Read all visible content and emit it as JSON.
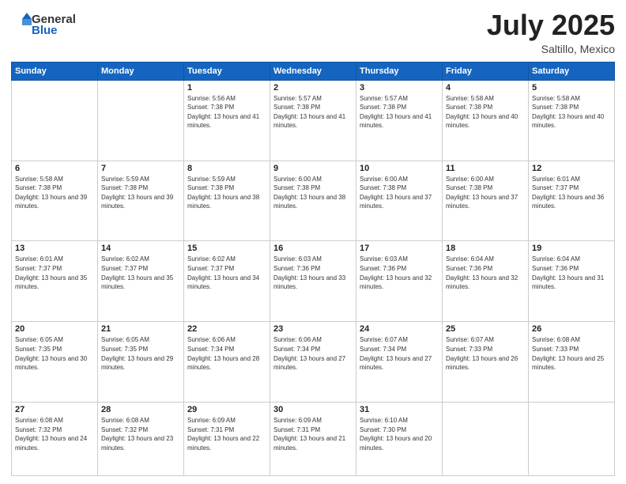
{
  "header": {
    "logo": {
      "line1": "General",
      "line2": "Blue"
    },
    "title": "July 2025",
    "subtitle": "Saltillo, Mexico"
  },
  "days_of_week": [
    "Sunday",
    "Monday",
    "Tuesday",
    "Wednesday",
    "Thursday",
    "Friday",
    "Saturday"
  ],
  "weeks": [
    [
      {
        "day": "",
        "info": ""
      },
      {
        "day": "",
        "info": ""
      },
      {
        "day": "1",
        "sunrise": "5:56 AM",
        "sunset": "7:38 PM",
        "daylight": "13 hours and 41 minutes."
      },
      {
        "day": "2",
        "sunrise": "5:57 AM",
        "sunset": "7:38 PM",
        "daylight": "13 hours and 41 minutes."
      },
      {
        "day": "3",
        "sunrise": "5:57 AM",
        "sunset": "7:38 PM",
        "daylight": "13 hours and 41 minutes."
      },
      {
        "day": "4",
        "sunrise": "5:58 AM",
        "sunset": "7:38 PM",
        "daylight": "13 hours and 40 minutes."
      },
      {
        "day": "5",
        "sunrise": "5:58 AM",
        "sunset": "7:38 PM",
        "daylight": "13 hours and 40 minutes."
      }
    ],
    [
      {
        "day": "6",
        "sunrise": "5:58 AM",
        "sunset": "7:38 PM",
        "daylight": "13 hours and 39 minutes."
      },
      {
        "day": "7",
        "sunrise": "5:59 AM",
        "sunset": "7:38 PM",
        "daylight": "13 hours and 39 minutes."
      },
      {
        "day": "8",
        "sunrise": "5:59 AM",
        "sunset": "7:38 PM",
        "daylight": "13 hours and 38 minutes."
      },
      {
        "day": "9",
        "sunrise": "6:00 AM",
        "sunset": "7:38 PM",
        "daylight": "13 hours and 38 minutes."
      },
      {
        "day": "10",
        "sunrise": "6:00 AM",
        "sunset": "7:38 PM",
        "daylight": "13 hours and 37 minutes."
      },
      {
        "day": "11",
        "sunrise": "6:00 AM",
        "sunset": "7:38 PM",
        "daylight": "13 hours and 37 minutes."
      },
      {
        "day": "12",
        "sunrise": "6:01 AM",
        "sunset": "7:37 PM",
        "daylight": "13 hours and 36 minutes."
      }
    ],
    [
      {
        "day": "13",
        "sunrise": "6:01 AM",
        "sunset": "7:37 PM",
        "daylight": "13 hours and 35 minutes."
      },
      {
        "day": "14",
        "sunrise": "6:02 AM",
        "sunset": "7:37 PM",
        "daylight": "13 hours and 35 minutes."
      },
      {
        "day": "15",
        "sunrise": "6:02 AM",
        "sunset": "7:37 PM",
        "daylight": "13 hours and 34 minutes."
      },
      {
        "day": "16",
        "sunrise": "6:03 AM",
        "sunset": "7:36 PM",
        "daylight": "13 hours and 33 minutes."
      },
      {
        "day": "17",
        "sunrise": "6:03 AM",
        "sunset": "7:36 PM",
        "daylight": "13 hours and 32 minutes."
      },
      {
        "day": "18",
        "sunrise": "6:04 AM",
        "sunset": "7:36 PM",
        "daylight": "13 hours and 32 minutes."
      },
      {
        "day": "19",
        "sunrise": "6:04 AM",
        "sunset": "7:36 PM",
        "daylight": "13 hours and 31 minutes."
      }
    ],
    [
      {
        "day": "20",
        "sunrise": "6:05 AM",
        "sunset": "7:35 PM",
        "daylight": "13 hours and 30 minutes."
      },
      {
        "day": "21",
        "sunrise": "6:05 AM",
        "sunset": "7:35 PM",
        "daylight": "13 hours and 29 minutes."
      },
      {
        "day": "22",
        "sunrise": "6:06 AM",
        "sunset": "7:34 PM",
        "daylight": "13 hours and 28 minutes."
      },
      {
        "day": "23",
        "sunrise": "6:06 AM",
        "sunset": "7:34 PM",
        "daylight": "13 hours and 27 minutes."
      },
      {
        "day": "24",
        "sunrise": "6:07 AM",
        "sunset": "7:34 PM",
        "daylight": "13 hours and 27 minutes."
      },
      {
        "day": "25",
        "sunrise": "6:07 AM",
        "sunset": "7:33 PM",
        "daylight": "13 hours and 26 minutes."
      },
      {
        "day": "26",
        "sunrise": "6:08 AM",
        "sunset": "7:33 PM",
        "daylight": "13 hours and 25 minutes."
      }
    ],
    [
      {
        "day": "27",
        "sunrise": "6:08 AM",
        "sunset": "7:32 PM",
        "daylight": "13 hours and 24 minutes."
      },
      {
        "day": "28",
        "sunrise": "6:08 AM",
        "sunset": "7:32 PM",
        "daylight": "13 hours and 23 minutes."
      },
      {
        "day": "29",
        "sunrise": "6:09 AM",
        "sunset": "7:31 PM",
        "daylight": "13 hours and 22 minutes."
      },
      {
        "day": "30",
        "sunrise": "6:09 AM",
        "sunset": "7:31 PM",
        "daylight": "13 hours and 21 minutes."
      },
      {
        "day": "31",
        "sunrise": "6:10 AM",
        "sunset": "7:30 PM",
        "daylight": "13 hours and 20 minutes."
      },
      {
        "day": "",
        "info": ""
      },
      {
        "day": "",
        "info": ""
      }
    ]
  ]
}
